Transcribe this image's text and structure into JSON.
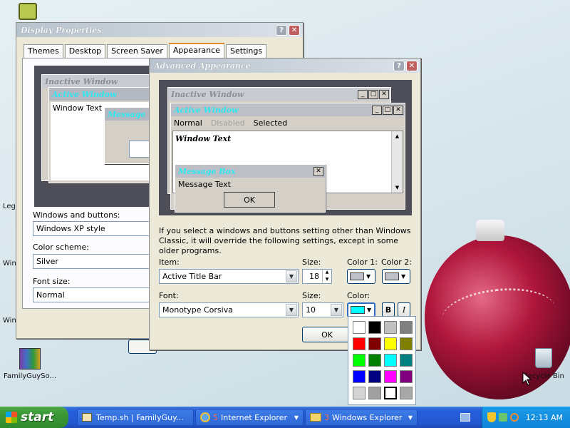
{
  "desktop": {
    "icons": [
      {
        "label": "FamilyGuySo..."
      },
      {
        "label": "Recycle Bin"
      }
    ],
    "edge_labels": [
      "Leg",
      "Win",
      "Win"
    ]
  },
  "display_properties": {
    "title": "Display Properties",
    "tabs": [
      "Themes",
      "Desktop",
      "Screen Saver",
      "Appearance",
      "Settings"
    ],
    "active_tab": "Appearance",
    "preview": {
      "inactive": "Inactive Window",
      "active": "Active Window",
      "window_text": "Window Text",
      "message": "Message"
    },
    "windows_buttons_label": "Windows and buttons:",
    "windows_buttons_value": "Windows XP style",
    "color_scheme_label": "Color scheme:",
    "color_scheme_value": "Silver",
    "font_size_label": "Font size:",
    "font_size_value": "Normal"
  },
  "advanced": {
    "title": "Advanced Appearance",
    "preview": {
      "inactive": "Inactive Window",
      "active": "Active Window",
      "menu": [
        "Normal",
        "Disabled",
        "Selected"
      ],
      "window_text": "Window Text",
      "message_box": "Message Box",
      "message_text": "Message Text",
      "ok": "OK"
    },
    "info": "If you select a windows and buttons setting other than Windows Classic, it will override the following settings, except in some older programs.",
    "item_label": "Item:",
    "item_value": "Active Title Bar",
    "size_label": "Size:",
    "size_value": "18",
    "color1_label": "Color 1:",
    "color2_label": "Color 2:",
    "font_label": "Font:",
    "font_value": "Monotype Corsiva",
    "font_size_label": "Size:",
    "font_size_value": "10",
    "color_label": "Color:",
    "bold": "B",
    "italic": "I",
    "ok": "OK",
    "colors": {
      "color1": "#c0c0c8",
      "color2": "#c0c0c8",
      "font_color": "#00ffff"
    }
  },
  "palette": [
    "#ffffff",
    "#000000",
    "#c0c0c0",
    "#808080",
    "#ff0000",
    "#800000",
    "#ffff00",
    "#808000",
    "#00ff00",
    "#008000",
    "#00ffff",
    "#008080",
    "#0000ff",
    "#000080",
    "#ff00ff",
    "#800080",
    "#d4d4d4",
    "#a0a0a0",
    "#ffffff",
    "#a8a8a8"
  ],
  "taskbar": {
    "start": "start",
    "tasks": [
      {
        "label": "Temp.sh | FamilyGuy..."
      },
      {
        "count": "5",
        "label": "Internet Explorer"
      },
      {
        "count": "3",
        "label": "Windows Explorer"
      }
    ],
    "clock": "12:13 AM"
  }
}
